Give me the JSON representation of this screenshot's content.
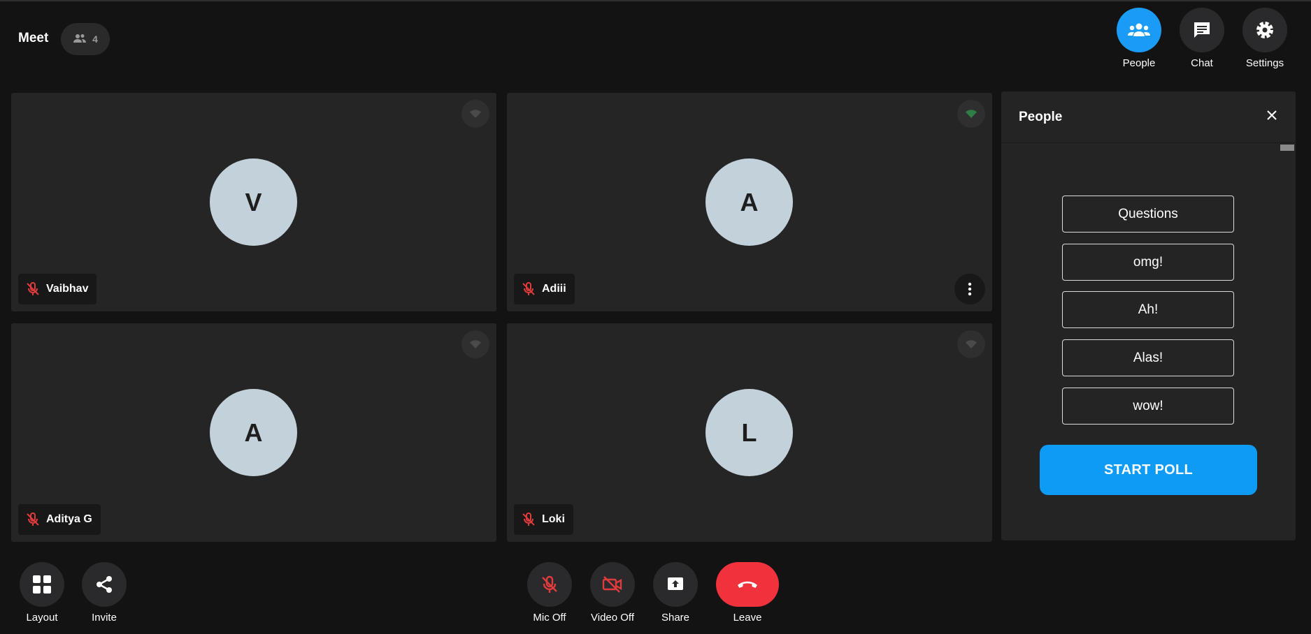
{
  "header": {
    "title": "Meet",
    "participant_count": "4",
    "buttons": {
      "people": "People",
      "chat": "Chat",
      "settings": "Settings"
    }
  },
  "participants": [
    {
      "initial": "V",
      "name": "Vaibhav"
    },
    {
      "initial": "A",
      "name": "Adiii"
    },
    {
      "initial": "A",
      "name": "Aditya G"
    },
    {
      "initial": "L",
      "name": "Loki"
    }
  ],
  "panel": {
    "title": "People",
    "poll": {
      "question": "Questions",
      "options": [
        "omg!",
        "Ah!",
        "Alas!",
        "wow!"
      ],
      "start_label": "START POLL"
    }
  },
  "controls": {
    "layout": "Layout",
    "invite": "Invite",
    "mic": "Mic Off",
    "video": "Video Off",
    "share": "Share",
    "leave": "Leave"
  },
  "colors": {
    "accent": "#1a9bf5",
    "leave": "#f0323c",
    "muted_icon": "#e23b3b",
    "avatar_bg": "#c3d1db"
  }
}
